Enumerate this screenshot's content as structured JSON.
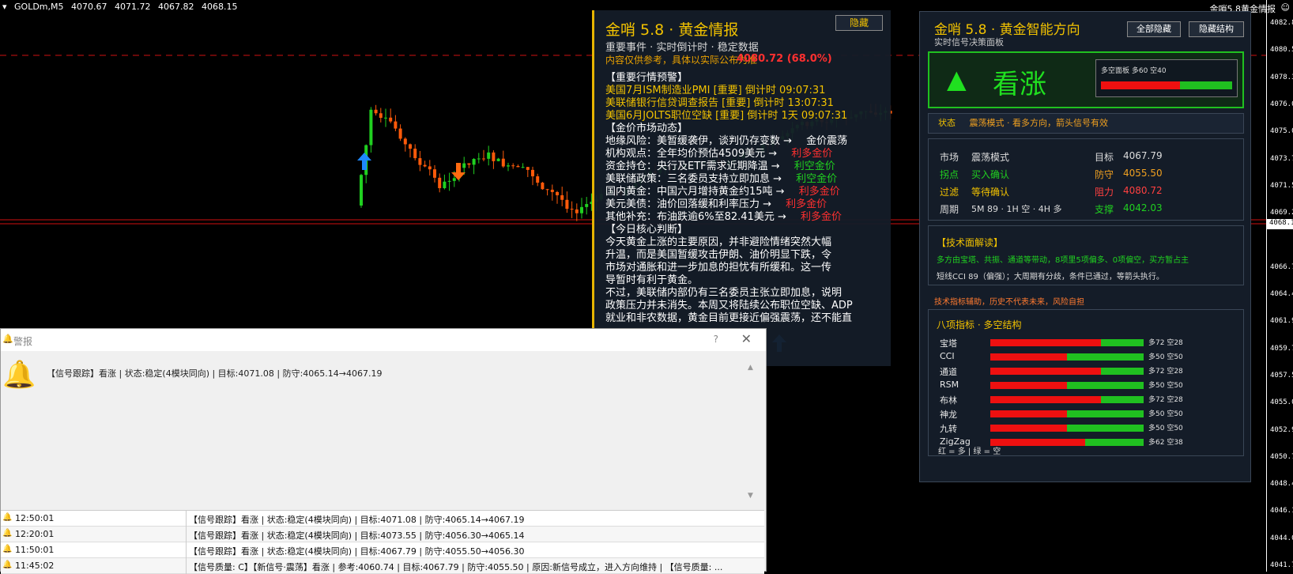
{
  "chart": {
    "symbol": "GOLDm,M5",
    "ohlc": [
      "4070.67",
      "4071.72",
      "4067.82",
      "4068.15"
    ],
    "top_right_label": "金哨5.8黄金情报",
    "y_ticks": [
      "4082.85",
      "4080.55",
      "4078.30",
      "4076.00",
      "4075.05",
      "4073.75",
      "4071.55",
      "4069.25",
      "4068.15",
      "4066.75",
      "4064.40",
      "4061.95",
      "4059.70",
      "4057.55",
      "4055.05",
      "4052.90",
      "4050.70",
      "4048.40",
      "4046.15",
      "4044.00",
      "4041.70"
    ],
    "current_price": "4068.15",
    "colors": {
      "bull": "#20d020",
      "bear": "#ff5a0a",
      "hline": "#d01010"
    }
  },
  "news": {
    "title": "金哨 5.8 · 黄金情报",
    "subtitle": "重要事件 · 实时倒计时 · 稳定数据",
    "disclaimer": "内容仅供参考，具体以实际公布为准",
    "disclaimer_num": "4080.72 (68.0%)",
    "hide_label": "隐藏",
    "sections": {
      "alert_head": "【重要行情预警】",
      "alerts": [
        "美国7月ISM制造业PMI [重要] 倒计时 09:07:31",
        "美联储银行信贷调查报告 [重要] 倒计时 13:07:31",
        "美国6月JOLTS职位空缺 [重要] 倒计时 1天 09:07:31"
      ],
      "market_head": "【金价市场动态】",
      "market": [
        {
          "text": "地缘风险：美暂缓袭伊，谈判仍存变数  →",
          "tag": "金价震荡",
          "tone": "neutral"
        },
        {
          "text": "机构观点：全年均价预估4509美元  →",
          "tag": "利多金价",
          "tone": "bull"
        },
        {
          "text": "资金持仓：央行及ETF需求近期降温  →",
          "tag": "利空金价",
          "tone": "bear"
        },
        {
          "text": "美联储政策：三名委员支持立即加息  →",
          "tag": "利空金价",
          "tone": "bear"
        },
        {
          "text": "国内黄金：中国六月增持黄金约15吨  →",
          "tag": "利多金价",
          "tone": "bull"
        },
        {
          "text": "美元美债：油价回落缓和利率压力  →",
          "tag": "利多金价",
          "tone": "bull"
        },
        {
          "text": "其他补充：布油跌逾6%至82.41美元  →",
          "tag": "利多金价",
          "tone": "bull"
        }
      ],
      "judge_head": "【今日核心判断】",
      "judge": [
        "今天黄金上涨的主要原因，并非避险情绪突然大幅",
        "升温，而是美国暂缓攻击伊朗、油价明显下跌，令",
        "市场对通胀和进一步加息的担忧有所缓和。这一传",
        "导暂时有利于黄金。",
        "不过，美联储内部仍有三名委员主张立即加息，说明",
        "政策压力并未消失。本周又将陆续公布职位空缺、ADP",
        "就业和非农数据，黄金目前更接近偏强震荡，还不能直"
      ]
    }
  },
  "signal": {
    "title": "金哨 5.8 · 黄金智能方向",
    "subtitle": "实时信号决策面板",
    "btn_hide_all": "全部隐藏",
    "btn_hide_struct": "隐藏结构",
    "direction_arrow": "▲",
    "direction": "看涨",
    "mini_label": "多空面板  多60 空40",
    "mini_bull": 0.6,
    "status_label": "状态",
    "status_text": "震荡模式 · 看多方向，箭头信号有效",
    "market_label": "市场",
    "market_val": "震荡模式",
    "entry_label": "拐点",
    "entry_val": "买入确认",
    "filter_label": "过滤",
    "filter_val": "等待确认",
    "period_label": "周期",
    "period_val": "5M 89 · 1H 空 · 4H 多",
    "target_label": "目标",
    "target_val": "4067.79",
    "defend_label": "防守",
    "defend_val": "4055.50",
    "resist_label": "阻力",
    "resist_val": "4080.72",
    "support_label": "支撑",
    "support_val": "4042.03",
    "tech_head": "【技术面解读】",
    "tech_line1": "多方由宝塔、共振、通道等带动，8项里5项偏多、0项偏空，买方暂占主",
    "tech_line2": "短线CCI 89（偏强）；大周期有分歧，条件已通过，等箭头执行。",
    "risk_note": "技术指标辅助，历史不代表未来，风险自担",
    "ind_head": "八项指标 · 多空结构",
    "indicators": [
      {
        "name": "宝塔",
        "bull": 0.72,
        "label": "多72 空28"
      },
      {
        "name": "CCI",
        "bull": 0.5,
        "label": "多50 空50"
      },
      {
        "name": "通道",
        "bull": 0.72,
        "label": "多72 空28"
      },
      {
        "name": "RSM",
        "bull": 0.5,
        "label": "多50 空50"
      },
      {
        "name": "布林",
        "bull": 0.72,
        "label": "多72 空28"
      },
      {
        "name": "神龙",
        "bull": 0.5,
        "label": "多50 空50"
      },
      {
        "name": "九转",
        "bull": 0.5,
        "label": "多50 空50"
      },
      {
        "name": "ZigZag",
        "bull": 0.62,
        "label": "多62 空38"
      }
    ],
    "legend": "红 = 多  |  绿 = 空"
  },
  "alert": {
    "title": "警报",
    "help": "?",
    "close": "✕",
    "message": "【信号跟踪】看涨 | 状态:稳定(4模块同向) | 目标:4071.08 | 防守:4065.14→4067.19",
    "rows": [
      {
        "time": "12:50:01",
        "text": "【信号跟踪】看涨 | 状态:稳定(4模块同向) | 目标:4071.08 | 防守:4065.14→4067.19"
      },
      {
        "time": "12:20:01",
        "text": "【信号跟踪】看涨 | 状态:稳定(4模块同向) | 目标:4073.55 | 防守:4056.30→4065.14"
      },
      {
        "time": "11:50:01",
        "text": "【信号跟踪】看涨 | 状态:稳定(4模块同向) | 目标:4067.79 | 防守:4055.50→4056.30"
      },
      {
        "time": "11:45:02",
        "text": "【信号质量: C】【新信号·震荡】看涨 | 参考:4060.74 | 目标:4067.79 | 防守:4055.50 | 原因:新信号成立，进入方向维持 | 【信号质量: ..."
      }
    ]
  }
}
